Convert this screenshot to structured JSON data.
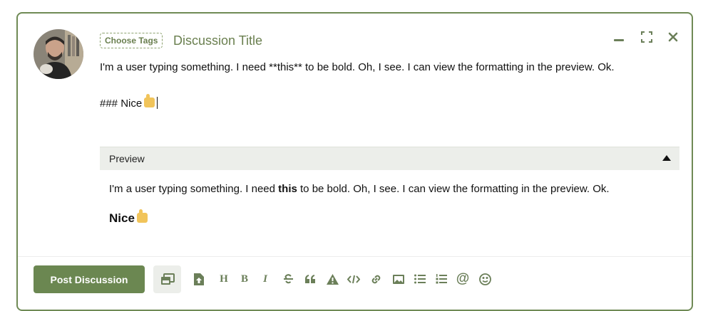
{
  "composer": {
    "tags_button_label": "Choose Tags",
    "title_placeholder": "Discussion Title",
    "body_line1": "I'm a user typing something. I need **this** to be bold. Oh, I see. I can view the formatting in the preview. Ok.",
    "body_line2": "### Nice"
  },
  "preview": {
    "label": "Preview",
    "text_before": "I'm a user typing something. I need ",
    "text_bold": "this",
    "text_after": " to be bold. Oh, I see. I can view the formatting in the preview. Ok.",
    "heading": "Nice"
  },
  "toolbar": {
    "post_label": "Post Discussion",
    "header_label": "H",
    "bold_label": "B",
    "italic_label": "I",
    "mention_label": "@"
  },
  "colors": {
    "accent": "#6b8751",
    "border": "#6f8a55",
    "muted": "#6b7f59",
    "preview_bg": "#eceeea"
  },
  "icons": [
    "minimize-icon",
    "fullscreen-icon",
    "close-icon",
    "preview-mode-icon",
    "upload-icon",
    "strikethrough-icon",
    "quote-icon",
    "spoiler-icon",
    "code-icon",
    "link-icon",
    "image-icon",
    "bullet-list-icon",
    "ordered-list-icon",
    "emoji-icon",
    "thumbs-up-icon"
  ]
}
